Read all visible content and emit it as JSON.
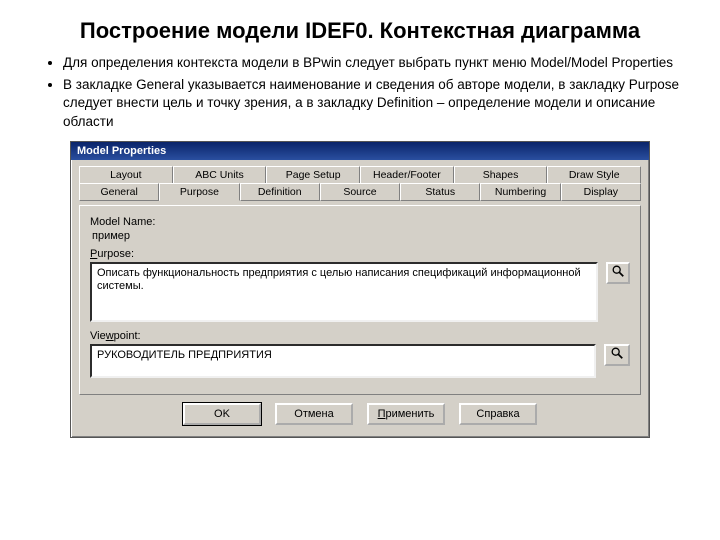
{
  "slide": {
    "title": "Построение модели IDEF0. Контекстная диаграмма",
    "bullets": [
      "Для определения контекста модели в BPwin следует выбрать пункт меню Model/Model Properties",
      "В закладке General указывается наименование и сведения об авторе модели, в закладку Purpose следует внести цель и точку зрения, а в закладку Definition – определение модели и описание области"
    ]
  },
  "dialog": {
    "title": "Model Properties",
    "tabs_back": [
      "Layout",
      "ABC Units",
      "Page Setup",
      "Header/Footer",
      "Shapes",
      "Draw Style"
    ],
    "tabs_front": [
      "General",
      "Purpose",
      "Definition",
      "Source",
      "Status",
      "Numbering",
      "Display"
    ],
    "active_tab": "Purpose",
    "labels": {
      "model_name": "Model Name:",
      "purpose": "Purpose:",
      "viewpoint": "Viewpoint:"
    },
    "values": {
      "model_name": "пример",
      "purpose": "Описать функциональность предприятия с целью написания спецификаций информационной системы.",
      "viewpoint": "РУКОВОДИТЕЛЬ ПРЕДПРИЯТИЯ"
    },
    "buttons": {
      "ok": "OK",
      "cancel": "Отмена",
      "apply": "Применить",
      "help": "Справка"
    }
  }
}
